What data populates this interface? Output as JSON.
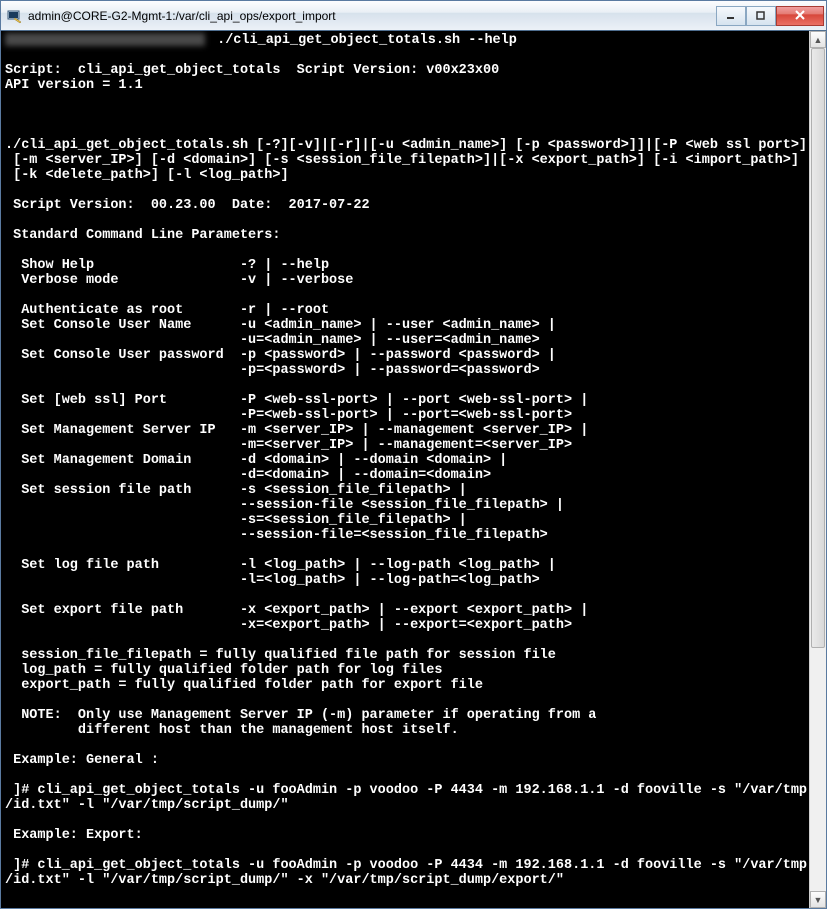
{
  "window": {
    "title": "admin@CORE-G2-Mgmt-1:/var/cli_api_ops/export_import",
    "buttons": {
      "minimize": "minimize-icon",
      "maximize": "maximize-icon",
      "close": "close-icon"
    }
  },
  "terminal": {
    "lines": [
      {
        "prefix_blur": true,
        "text": " ./cli_api_get_object_totals.sh --help"
      },
      {
        "text": ""
      },
      {
        "text": "Script:  cli_api_get_object_totals  Script Version: v00x23x00"
      },
      {
        "text": "API version = 1.1"
      },
      {
        "text": ""
      },
      {
        "text": ""
      },
      {
        "text": ""
      },
      {
        "text": "./cli_api_get_object_totals.sh [-?][-v]|[-r]|[-u <admin_name>] [-p <password>]]|[-P <web ssl port>]"
      },
      {
        "text": " [-m <server_IP>] [-d <domain>] [-s <session_file_filepath>]|[-x <export_path>] [-i <import_path>]"
      },
      {
        "text": " [-k <delete_path>] [-l <log_path>]"
      },
      {
        "text": ""
      },
      {
        "text": " Script Version:  00.23.00  Date:  2017-07-22"
      },
      {
        "text": ""
      },
      {
        "text": " Standard Command Line Parameters:"
      },
      {
        "text": ""
      },
      {
        "text": "  Show Help                  -? | --help"
      },
      {
        "text": "  Verbose mode               -v | --verbose"
      },
      {
        "text": ""
      },
      {
        "text": "  Authenticate as root       -r | --root"
      },
      {
        "text": "  Set Console User Name      -u <admin_name> | --user <admin_name> |"
      },
      {
        "text": "                             -u=<admin_name> | --user=<admin_name>"
      },
      {
        "text": "  Set Console User password  -p <password> | --password <password> |"
      },
      {
        "text": "                             -p=<password> | --password=<password>"
      },
      {
        "text": ""
      },
      {
        "text": "  Set [web ssl] Port         -P <web-ssl-port> | --port <web-ssl-port> |"
      },
      {
        "text": "                             -P=<web-ssl-port> | --port=<web-ssl-port>"
      },
      {
        "text": "  Set Management Server IP   -m <server_IP> | --management <server_IP> |"
      },
      {
        "text": "                             -m=<server_IP> | --management=<server_IP>"
      },
      {
        "text": "  Set Management Domain      -d <domain> | --domain <domain> |"
      },
      {
        "text": "                             -d=<domain> | --domain=<domain>"
      },
      {
        "text": "  Set session file path      -s <session_file_filepath> |"
      },
      {
        "text": "                             --session-file <session_file_filepath> |"
      },
      {
        "text": "                             -s=<session_file_filepath> |"
      },
      {
        "text": "                             --session-file=<session_file_filepath>"
      },
      {
        "text": ""
      },
      {
        "text": "  Set log file path          -l <log_path> | --log-path <log_path> |"
      },
      {
        "text": "                             -l=<log_path> | --log-path=<log_path>"
      },
      {
        "text": ""
      },
      {
        "text": "  Set export file path       -x <export_path> | --export <export_path> |"
      },
      {
        "text": "                             -x=<export_path> | --export=<export_path>"
      },
      {
        "text": ""
      },
      {
        "text": "  session_file_filepath = fully qualified file path for session file"
      },
      {
        "text": "  log_path = fully qualified folder path for log files"
      },
      {
        "text": "  export_path = fully qualified folder path for export file"
      },
      {
        "text": ""
      },
      {
        "text": "  NOTE:  Only use Management Server IP (-m) parameter if operating from a"
      },
      {
        "text": "         different host than the management host itself."
      },
      {
        "text": ""
      },
      {
        "text": " Example: General :"
      },
      {
        "text": ""
      },
      {
        "text": " ]# cli_api_get_object_totals -u fooAdmin -p voodoo -P 4434 -m 192.168.1.1 -d fooville -s \"/var/tmp"
      },
      {
        "text": "/id.txt\" -l \"/var/tmp/script_dump/\""
      },
      {
        "text": ""
      },
      {
        "text": " Example: Export:"
      },
      {
        "text": ""
      },
      {
        "text": " ]# cli_api_get_object_totals -u fooAdmin -p voodoo -P 4434 -m 192.168.1.1 -d fooville -s \"/var/tmp"
      },
      {
        "text": "/id.txt\" -l \"/var/tmp/script_dump/\" -x \"/var/tmp/script_dump/export/\""
      },
      {
        "text": ""
      }
    ]
  },
  "scrollbar": {
    "up": "▲",
    "down": "▼"
  }
}
